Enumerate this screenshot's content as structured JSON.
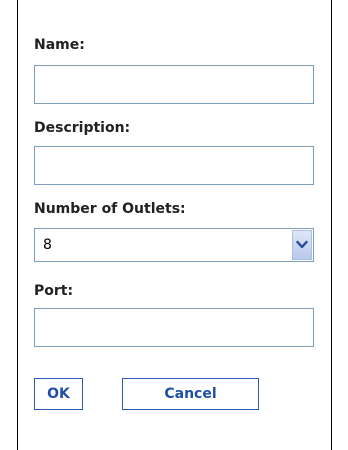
{
  "form": {
    "name": {
      "label": "Name:",
      "value": ""
    },
    "description": {
      "label": "Description:",
      "value": ""
    },
    "outlets": {
      "label": "Number of Outlets:",
      "selected": "8"
    },
    "port": {
      "label": "Port:",
      "value": ""
    }
  },
  "buttons": {
    "ok_label": "OK",
    "cancel_label": "Cancel"
  },
  "colors": {
    "button_text": "#1f4fa8",
    "button_border": "#2b5fb5",
    "input_border": "#7f9db9",
    "dropdown_arrow_bg": "#c9d6f2"
  },
  "icons": {
    "dropdown": "chevron-down-icon"
  }
}
